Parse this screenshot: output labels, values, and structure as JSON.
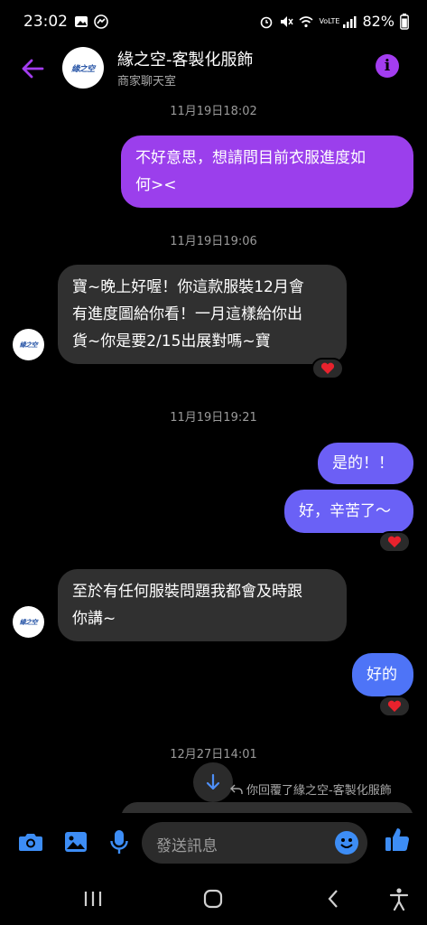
{
  "status": {
    "time": "23:02",
    "battery": "82%",
    "network": "VoLTE"
  },
  "header": {
    "title": "緣之空-客製化服飾",
    "subtitle": "商家聊天室",
    "logo_text": "緣之空"
  },
  "messages": [
    {
      "type": "timestamp",
      "text": "11月19日18:02"
    },
    {
      "type": "outgoing",
      "text_lines": [
        "不好意思，想請問目前衣服進度如",
        "何><"
      ]
    },
    {
      "type": "timestamp",
      "text": "11月19日19:06"
    },
    {
      "type": "incoming",
      "text_lines": [
        "寶~晚上好喔！你這款服裝12月會",
        "有進度圖給你看！一月這樣給你出",
        "貨~你是要2/15出展對嗎~寶"
      ],
      "reaction": "heart"
    },
    {
      "type": "timestamp",
      "text": "11月19日19:21"
    },
    {
      "type": "outgoing",
      "text": "是的！！"
    },
    {
      "type": "outgoing",
      "text": "好，辛苦了～",
      "reaction": "heart"
    },
    {
      "type": "incoming",
      "text_lines": [
        "至於有任何服裝問題我都會及時跟",
        "你講~"
      ]
    },
    {
      "type": "outgoing",
      "text": "好的",
      "reaction": "heart"
    },
    {
      "type": "timestamp",
      "text": "12月27日14:01"
    }
  ],
  "reply_note": "你回覆了緣之空-客製化服飾",
  "composer": {
    "placeholder": "發送訊息"
  },
  "colors": {
    "accent": "#a33df0",
    "out_purple": "#9b3fec",
    "out_blue": "#4e74f7",
    "incoming": "#303030"
  }
}
